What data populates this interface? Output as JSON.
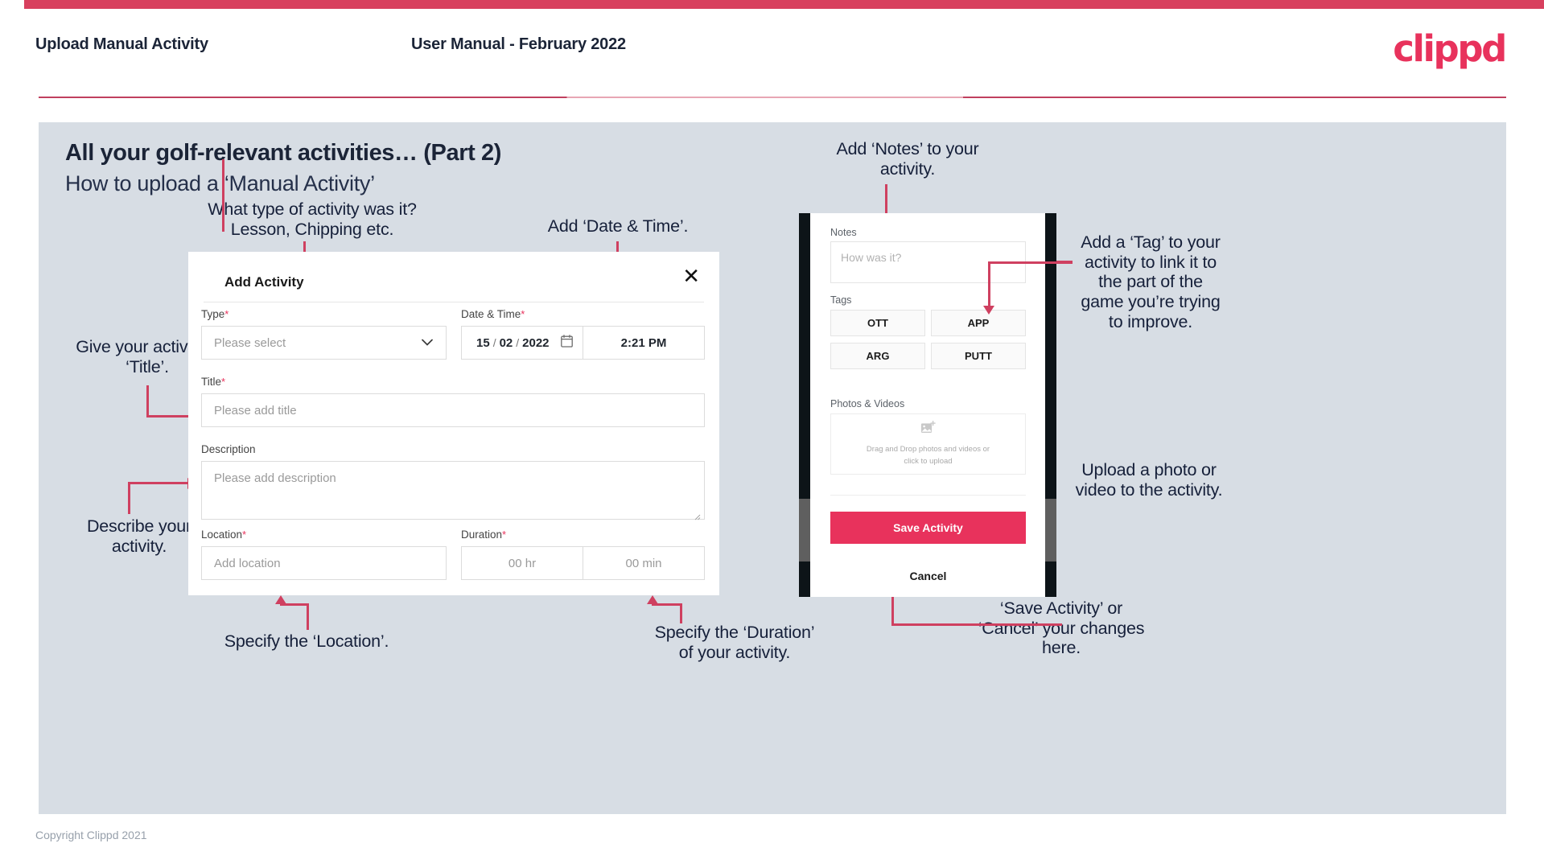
{
  "header": {
    "left_title": "Upload Manual Activity",
    "center_title": "User Manual - February 2022",
    "logo": "clippd"
  },
  "slide": {
    "title": "All your golf-relevant activities… (Part 2)",
    "subtitle": "How to upload a ‘Manual Activity’"
  },
  "dialog": {
    "title": "Add Activity",
    "close_icon": "close-icon",
    "fields": {
      "type_label": "Type",
      "type_placeholder": "Please select",
      "datetime_label": "Date & Time",
      "date_day": "15",
      "date_sep1": "/",
      "date_month": "02",
      "date_sep2": "/",
      "date_year": "2022",
      "calendar_icon": "calendar-icon",
      "time_value": "2:21 PM",
      "title_label": "Title",
      "title_placeholder": "Please add title",
      "description_label": "Description",
      "description_placeholder": "Please add description",
      "location_label": "Location",
      "location_placeholder": "Add location",
      "duration_label": "Duration",
      "duration_hr_placeholder": "00 hr",
      "duration_min_placeholder": "00 min"
    },
    "required_marker": "*"
  },
  "phone": {
    "notes_label": "Notes",
    "notes_placeholder": "How was it?",
    "tags_label": "Tags",
    "tags": [
      "OTT",
      "APP",
      "ARG",
      "PUTT"
    ],
    "photos_label": "Photos & Videos",
    "dropzone_icon": "add-image-icon",
    "dropzone_text_line1": "Drag and Drop photos and videos or",
    "dropzone_text_line2": "click to upload",
    "save_label": "Save Activity",
    "cancel_label": "Cancel"
  },
  "annotations": {
    "type": "What type of activity was it?\nLesson, Chipping etc.",
    "datetime": "Add ‘Date & Time’.",
    "title": "Give your activity a\n‘Title’.",
    "description": "Describe your\nactivity.",
    "location": "Specify the ‘Location’.",
    "duration": "Specify the ‘Duration’\nof your activity.",
    "notes": "Add ‘Notes’ to your\nactivity.",
    "tags": "Add a ‘Tag’ to your\nactivity to link it to\nthe part of the\ngame you’re trying\nto improve.",
    "upload": "Upload a photo or\nvideo to the activity.",
    "save_cancel": "‘Save Activity’ or\n‘Cancel’ your changes\nhere."
  },
  "footer": {
    "copyright": "Copyright Clippd 2021"
  },
  "colors": {
    "brand_pink": "#e8325c",
    "arrow_pink": "#cf4060",
    "canvas_bg": "#d7dde4",
    "text_dark": "#16203a"
  }
}
